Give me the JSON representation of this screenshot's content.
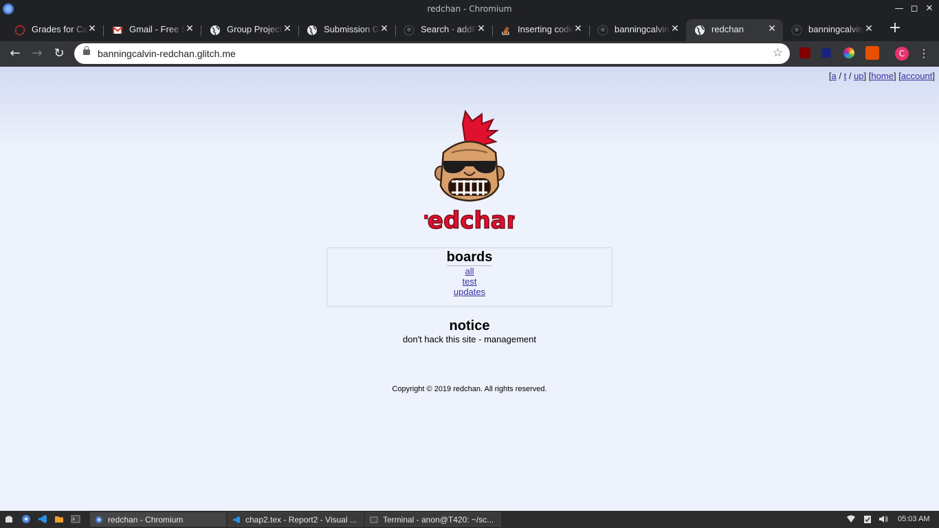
{
  "window": {
    "title": "redchan - Chromium"
  },
  "tabs": [
    {
      "label": "Grades for Calvin",
      "icon": "canvas-icon"
    },
    {
      "label": "Gmail - Free Storage",
      "icon": "gmail-icon"
    },
    {
      "label": "Group Project",
      "icon": "globe-icon"
    },
    {
      "label": "Submission Guidelines",
      "icon": "globe-icon"
    },
    {
      "label": "Search · addPost",
      "icon": "github-icon"
    },
    {
      "label": "Inserting code",
      "icon": "stackoverflow-icon"
    },
    {
      "label": "banningcalvin",
      "icon": "github-icon"
    },
    {
      "label": "redchan",
      "icon": "globe-icon",
      "active": true
    },
    {
      "label": "banningcalvin",
      "icon": "github-icon"
    }
  ],
  "toolbar": {
    "url": "banningcalvin-redchan.glitch.me",
    "profile_initial": "C"
  },
  "page": {
    "topnav": {
      "open": "[",
      "a": "a",
      "sep1": " / ",
      "t": "t",
      "sep2": " / ",
      "up": "up",
      "close": "]",
      "home": "home",
      "account": "account"
    },
    "logo_text": "redchan",
    "boards": {
      "title": "boards",
      "links": [
        "all",
        "test",
        "updates"
      ]
    },
    "notice": {
      "title": "notice",
      "text": "don't hack this site - management"
    },
    "copyright": "Copyright © 2019 redchan. All rights reserved."
  },
  "taskbar": {
    "tasks": [
      "redchan - Chromium",
      "chap2.tex - Report2 - Visual ...",
      "Terminal - anon@T420: ~/sc..."
    ],
    "clock": "05:03 AM"
  },
  "colors": {
    "accent_red": "#e0102f",
    "link": "#3b2fa0",
    "tab_bg": "#202124",
    "toolbar_bg": "#35363a"
  }
}
